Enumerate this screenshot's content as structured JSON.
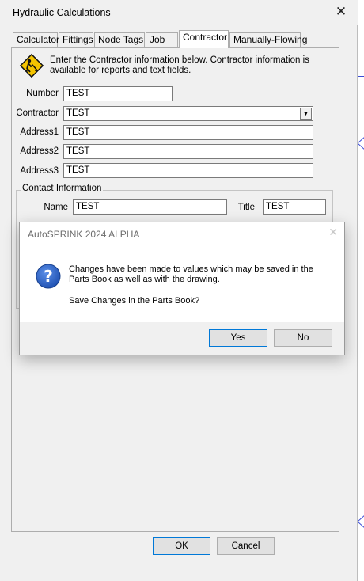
{
  "main_dialog": {
    "title": "Hydraulic Calculations",
    "tabs": [
      {
        "label": "Calculator"
      },
      {
        "label": "Fittings"
      },
      {
        "label": "Node Tags"
      },
      {
        "label": "Job"
      },
      {
        "label": "Contractor"
      },
      {
        "label": "Manually-Flowing"
      }
    ],
    "active_tab": "Contractor",
    "info_text": "Enter the Contractor information below. Contractor information is available for reports and text fields.",
    "fields": {
      "number_label": "Number",
      "number_value": "TEST",
      "contractor_label": "Contractor",
      "contractor_value": "TEST",
      "address1_label": "Address1",
      "address1_value": "TEST",
      "address2_label": "Address2",
      "address2_value": "TEST",
      "address3_label": "Address3",
      "address3_value": "TEST"
    },
    "contact": {
      "group_title": "Contact Information",
      "name_label": "Name",
      "name_value": "TEST",
      "title_label": "Title",
      "title_value": "TEST"
    },
    "buttons": {
      "ok": "OK",
      "cancel": "Cancel"
    }
  },
  "modal": {
    "title": "AutoSPRINK 2024 ALPHA",
    "message": "Changes have been made to values which may be saved in the Parts Book as well as with the drawing.",
    "question": "Save Changes in the Parts Book?",
    "yes": "Yes",
    "no": "No"
  },
  "icons": {
    "close": "close-icon",
    "contractor": "construction-worker-icon",
    "question": "question-icon",
    "dropdown": "chevron-down-icon"
  },
  "colors": {
    "accent": "#0078d7",
    "question_icon": "#2b5fbf",
    "warning_sign": "#f4c400"
  }
}
